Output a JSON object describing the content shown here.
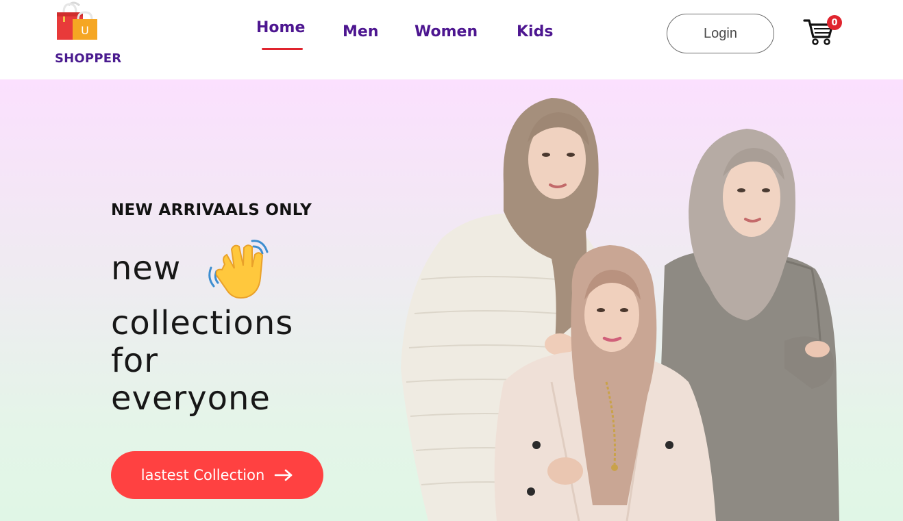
{
  "brand": {
    "name": "SHOPPER",
    "bag_letter": "U"
  },
  "nav": {
    "items": [
      {
        "label": "Home",
        "active": true
      },
      {
        "label": "Men",
        "active": false
      },
      {
        "label": "Women",
        "active": false
      },
      {
        "label": "Kids",
        "active": false
      }
    ],
    "active_color": "#e0242e",
    "text_color": "#4d1690"
  },
  "auth": {
    "login_label": "Login"
  },
  "cart": {
    "icon": "cart-icon",
    "count": "0"
  },
  "hero": {
    "subtitle": "NEW ARRIVAALS ONLY",
    "line1": "new",
    "line2": "collections",
    "line3": "for",
    "line4": "everyone",
    "emoji": "waving-hand-icon",
    "cta_label": "lastest Collection",
    "cta_icon": "arrow-right-icon",
    "cta_color": "#ff4141"
  }
}
